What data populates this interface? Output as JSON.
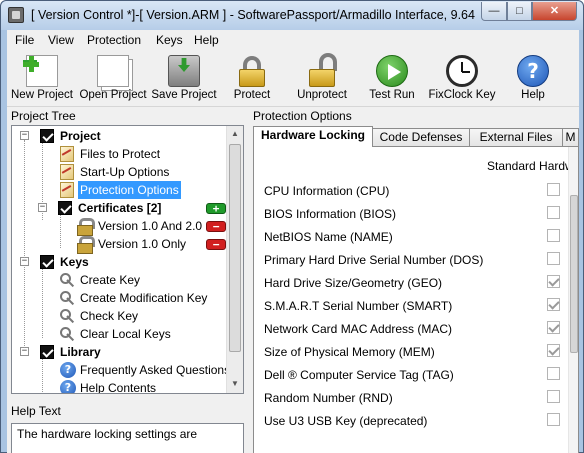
{
  "window": {
    "title": "[ Version Control *]-[ Version.ARM ] - SoftwarePassport/Armadillo Interface, 9.64",
    "minimize_glyph": "—",
    "maximize_glyph": "□",
    "close_glyph": "✕"
  },
  "menu": [
    "File",
    "View",
    "Protection",
    "Keys",
    "Help"
  ],
  "toolbar": [
    {
      "label": "New Project",
      "icon": "new-project-icon"
    },
    {
      "label": "Open Project",
      "icon": "open-project-icon"
    },
    {
      "label": "Save Project",
      "icon": "save-project-icon"
    },
    {
      "label": "Protect",
      "icon": "lock-icon"
    },
    {
      "label": "Unprotect",
      "icon": "unlock-icon"
    },
    {
      "label": "Test Run",
      "icon": "play-icon"
    },
    {
      "label": "FixClock Key",
      "icon": "clock-icon"
    },
    {
      "label": "Help",
      "icon": "help-icon"
    }
  ],
  "left_panel": {
    "header": "Project Tree",
    "tree": {
      "project": "Project",
      "files": "Files to Protect",
      "startup": "Start-Up Options",
      "protection": "Protection Options",
      "certificates": "Certificates [2]",
      "cert1": "Version 1.0 And 2.0",
      "cert2": "Version 1.0 Only",
      "keys": "Keys",
      "create_key": "Create Key",
      "create_mod_key": "Create Modification Key",
      "check_key": "Check Key",
      "clear_keys": "Clear Local Keys",
      "library": "Library",
      "faq": "Frequently Asked Questions",
      "help_contents": "Help Contents"
    },
    "badge_add": "+",
    "badge_remove": "−",
    "help_header": "Help Text",
    "help_text": "The hardware locking settings are"
  },
  "right_panel": {
    "header": "Protection Options",
    "tabs": [
      "Hardware Locking",
      "Code Defenses",
      "External Files",
      "M"
    ],
    "column_header": "Standard Hardw",
    "options": [
      {
        "label": "CPU Information (CPU)",
        "checked": false
      },
      {
        "label": "BIOS Information (BIOS)",
        "checked": false
      },
      {
        "label": "NetBIOS Name (NAME)",
        "checked": false
      },
      {
        "label": "Primary Hard Drive Serial Number (DOS)",
        "checked": false
      },
      {
        "label": "Hard Drive Size/Geometry (GEO)",
        "checked": true
      },
      {
        "label": "S.M.A.R.T Serial Number (SMART)",
        "checked": true
      },
      {
        "label": "Network Card MAC Address (MAC)",
        "checked": true
      },
      {
        "label": "Size of Physical Memory (MEM)",
        "checked": true
      },
      {
        "label": "Dell ® Computer Service Tag (TAG)",
        "checked": false
      },
      {
        "label": "Random Number (RND)",
        "checked": false
      },
      {
        "label": "Use U3 USB Key (deprecated)",
        "checked": false
      }
    ]
  }
}
